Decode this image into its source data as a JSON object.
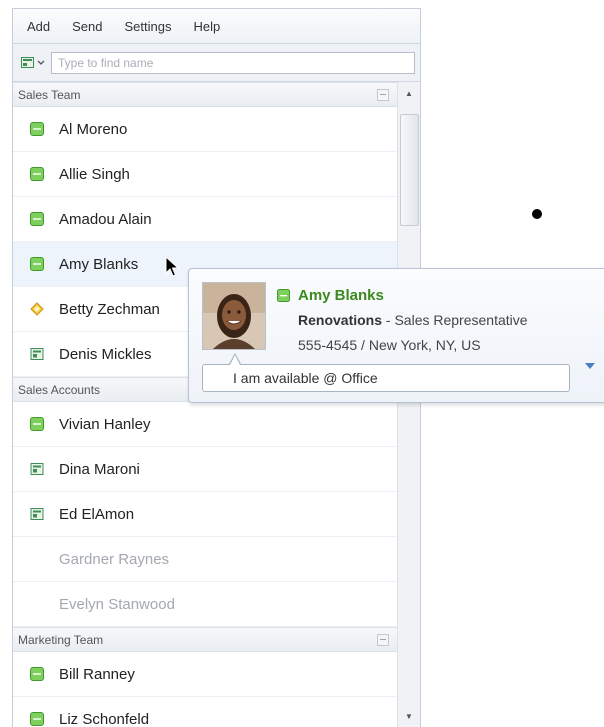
{
  "menu": [
    "Add",
    "Send",
    "Settings",
    "Help"
  ],
  "search": {
    "placeholder": "Type to find name"
  },
  "groups": [
    {
      "name": "Sales Team",
      "contacts": [
        {
          "name": "Al Moreno",
          "status": "available"
        },
        {
          "name": "Allie Singh",
          "status": "available"
        },
        {
          "name": "Amadou Alain",
          "status": "available"
        },
        {
          "name": "Amy Blanks",
          "status": "available",
          "hovered": true
        },
        {
          "name": "Betty Zechman",
          "status": "away"
        },
        {
          "name": "Denis Mickles",
          "status": "in-meeting"
        }
      ]
    },
    {
      "name": "Sales Accounts",
      "contacts": [
        {
          "name": "Vivian Hanley",
          "status": "available"
        },
        {
          "name": "Dina Maroni",
          "status": "in-meeting"
        },
        {
          "name": "Ed ElAmon",
          "status": "in-meeting"
        },
        {
          "name": "Gardner Raynes",
          "status": "offline"
        },
        {
          "name": "Evelyn Stanwood",
          "status": "offline"
        }
      ]
    },
    {
      "name": "Marketing Team",
      "contacts": [
        {
          "name": "Bill Ranney",
          "status": "available"
        },
        {
          "name": "Liz Schonfeld",
          "status": "available"
        }
      ]
    }
  ],
  "card": {
    "name": "Amy Blanks",
    "company": "Renovations",
    "separator": " - ",
    "title": "Sales Representative",
    "location": "555-4545 / New York, NY, US",
    "status_message": "I am available @ Office"
  },
  "colors": {
    "available": "#4cb034",
    "away": "#e8b21a",
    "in-meeting": "#3d8c5a",
    "name_green": "#3c8a1e"
  }
}
